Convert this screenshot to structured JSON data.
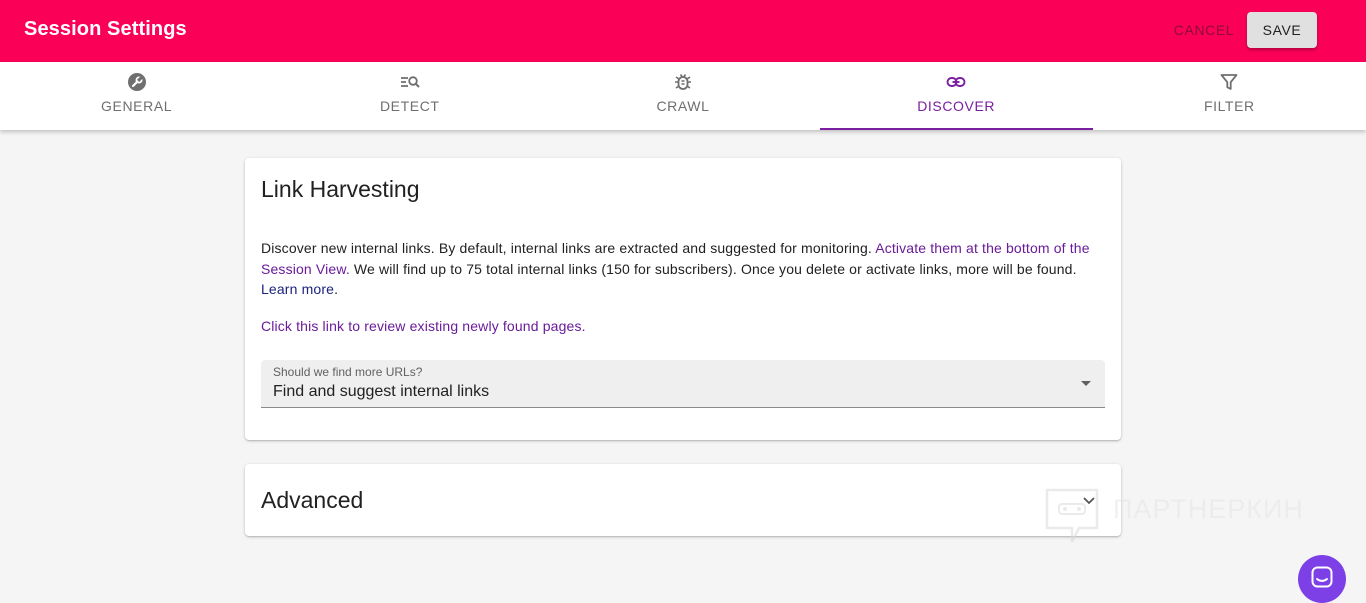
{
  "appbar": {
    "title": "Session Settings",
    "cancel_label": "CANCEL",
    "save_label": "SAVE",
    "color": "#fa0057"
  },
  "tabs": [
    {
      "label": "GENERAL",
      "icon": "wrench-icon"
    },
    {
      "label": "DETECT",
      "icon": "list-search-icon"
    },
    {
      "label": "CRAWL",
      "icon": "bug-icon"
    },
    {
      "label": "DISCOVER",
      "icon": "link-icon",
      "active": true
    },
    {
      "label": "FILTER",
      "icon": "filter-icon"
    }
  ],
  "link_harvesting": {
    "title": "Link Harvesting",
    "desc_text_1": "Discover new internal links. By default, internal links are extracted and suggested for monitoring.",
    "desc_link_1": "Activate them at the bottom of the Session View.",
    "desc_text_2": "We will find up to 75 total internal links (150 for subscribers). Once you delete or activate links, more will be found.",
    "desc_link_2": "Learn more",
    "desc_text_3": ".",
    "review_link": "Click this link to review existing newly found pages.",
    "select_label": "Should we find more URLs?",
    "select_value": "Find and suggest internal links"
  },
  "advanced": {
    "title": "Advanced"
  },
  "watermark": {
    "text": "ПАРТНЕРКИН"
  },
  "chat_button": {
    "icon": "chat-icon",
    "color": "#7d40e7"
  },
  "accent_color": "#7b1fa2"
}
